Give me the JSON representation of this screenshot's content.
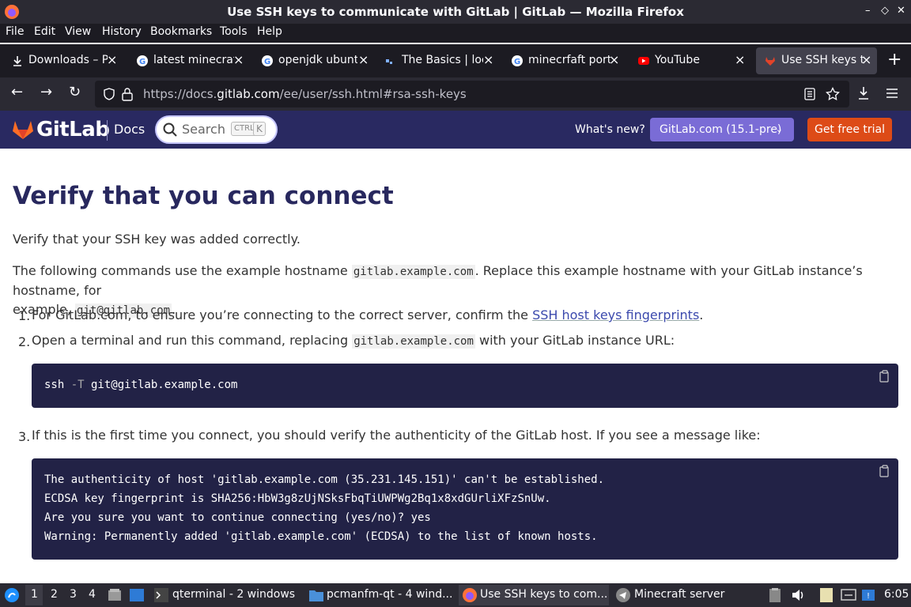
{
  "window": {
    "title": "Use SSH keys to communicate with GitLab | GitLab — Mozilla Firefox",
    "controls": [
      "–",
      "◇",
      "✕"
    ]
  },
  "menu": [
    "File",
    "Edit",
    "View",
    "History",
    "Bookmarks",
    "Tools",
    "Help"
  ],
  "tabs": [
    {
      "label": "Downloads – Pa",
      "icon": "download-icon"
    },
    {
      "label": "latest minecraf",
      "icon": "google-icon"
    },
    {
      "label": "openjdk ubuntu",
      "icon": "google-icon"
    },
    {
      "label": "The Basics | loc",
      "icon": "page-icon"
    },
    {
      "label": "minecrfaft port",
      "icon": "google-icon"
    },
    {
      "label": "YouTube",
      "icon": "youtube-icon"
    },
    {
      "label": "Use SSH keys t",
      "icon": "gitlab-icon",
      "active": true
    }
  ],
  "url": {
    "prefix": "https://docs.",
    "domain": "gitlab.com",
    "rest": "/ee/user/ssh.html#rsa-ssh-keys"
  },
  "gitlab": {
    "brand": "GitLab",
    "docs": "Docs",
    "search_placeholder": "Search",
    "kbd_ctrl": "CTRL",
    "kbd_k": "K",
    "whats_new": "What's new?",
    "version": "GitLab.com (15.1-pre)",
    "trial": "Get free trial"
  },
  "article": {
    "heading": "Verify that you can connect",
    "intro": "Verify that your SSH key was added correctly.",
    "p2_a": "The following commands use the example hostname ",
    "p2_code1": "gitlab.example.com",
    "p2_b": ". Replace this example hostname with your GitLab instance’s hostname, for",
    "p2_c": "example, ",
    "p2_code2": "git@gitlab.com",
    "p2_d": ".",
    "step1_num": "1.",
    "step1_a": "For GitLab.com, to ensure you’re connecting to the correct server, confirm the ",
    "step1_link": "SSH host keys fingerprints",
    "step1_b": ".",
    "step2_num": "2.",
    "step2_a": "Open a terminal and run this command, replacing ",
    "step2_code": "gitlab.example.com",
    "step2_b": " with your GitLab instance URL:",
    "code1_cmd": "ssh ",
    "code1_flag": "-T",
    "code1_arg": " git@gitlab.example.com",
    "step3_num": "3.",
    "step3": "If this is the first time you connect, you should verify the authenticity of the GitLab host. If you see a message like:",
    "code2_lines": [
      "The authenticity of host 'gitlab.example.com (35.231.145.151)' can't be established.",
      "ECDSA key fingerprint is SHA256:HbW3g8zUjNSksFbqTiUWPWg2Bq1x8xdGUrliXFzSnUw.",
      "Are you sure you want to continue connecting (yes/no)? yes",
      "Warning: Permanently added 'gitlab.example.com' (ECDSA) to the list of known hosts."
    ]
  },
  "taskbar": {
    "workspaces": [
      "1",
      "2",
      "3",
      "4"
    ],
    "items": [
      {
        "label": "qterminal - 2 windows"
      },
      {
        "label": "pcmanfm-qt - 4 wind..."
      },
      {
        "label": "Use SSH keys to com..."
      },
      {
        "label": "Minecraft server"
      }
    ],
    "clock": "6:05"
  },
  "colors": {
    "gitlab_header": "#292961",
    "trial": "#dd4b17",
    "version": "#7a6cd6",
    "code_bg": "#222246"
  }
}
